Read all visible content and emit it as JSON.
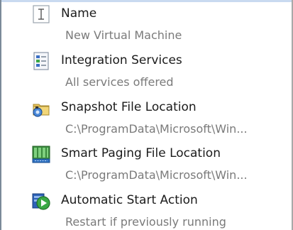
{
  "settings": {
    "items": [
      {
        "title": "Name",
        "subtitle": "New Virtual Machine",
        "icon": "name-icon"
      },
      {
        "title": "Integration Services",
        "subtitle": "All services offered",
        "icon": "integration-services-icon"
      },
      {
        "title": "Snapshot File Location",
        "subtitle": "C:\\ProgramData\\Microsoft\\Win...",
        "icon": "snapshot-icon"
      },
      {
        "title": "Smart Paging File Location",
        "subtitle": "C:\\ProgramData\\Microsoft\\Win...",
        "icon": "smart-paging-icon"
      },
      {
        "title": "Automatic Start Action",
        "subtitle": "Restart if previously running",
        "icon": "automatic-start-icon"
      }
    ]
  },
  "colors": {
    "title_text": "#1b1b1b",
    "subtitle_text": "#7a7a7a",
    "accent_blue": "#3a6fc4",
    "accent_green": "#3aa845"
  }
}
